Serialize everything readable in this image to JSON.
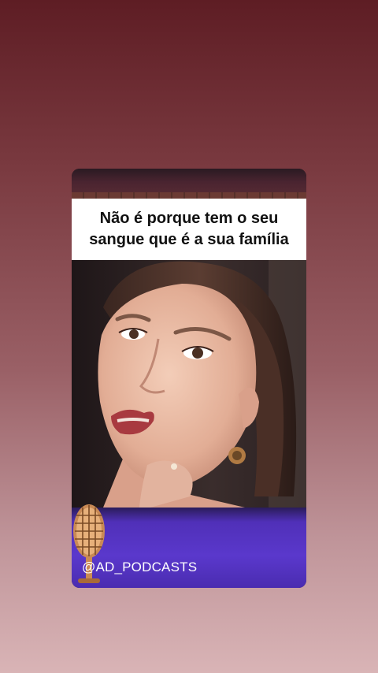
{
  "post": {
    "caption": "Não é porque tem o seu sangue que é a sua família",
    "handle": "@AD_PODCASTS",
    "video_description_icon": "woman-speaking-photo"
  },
  "icons": {
    "microphone": "microphone-icon"
  },
  "colors": {
    "background_top": "#5e1d24",
    "background_bottom": "#d9b4b6",
    "caption_bg": "#ffffff",
    "caption_text": "#111111",
    "band_purple": "#5a38cc",
    "handle_text": "#ffffff"
  }
}
